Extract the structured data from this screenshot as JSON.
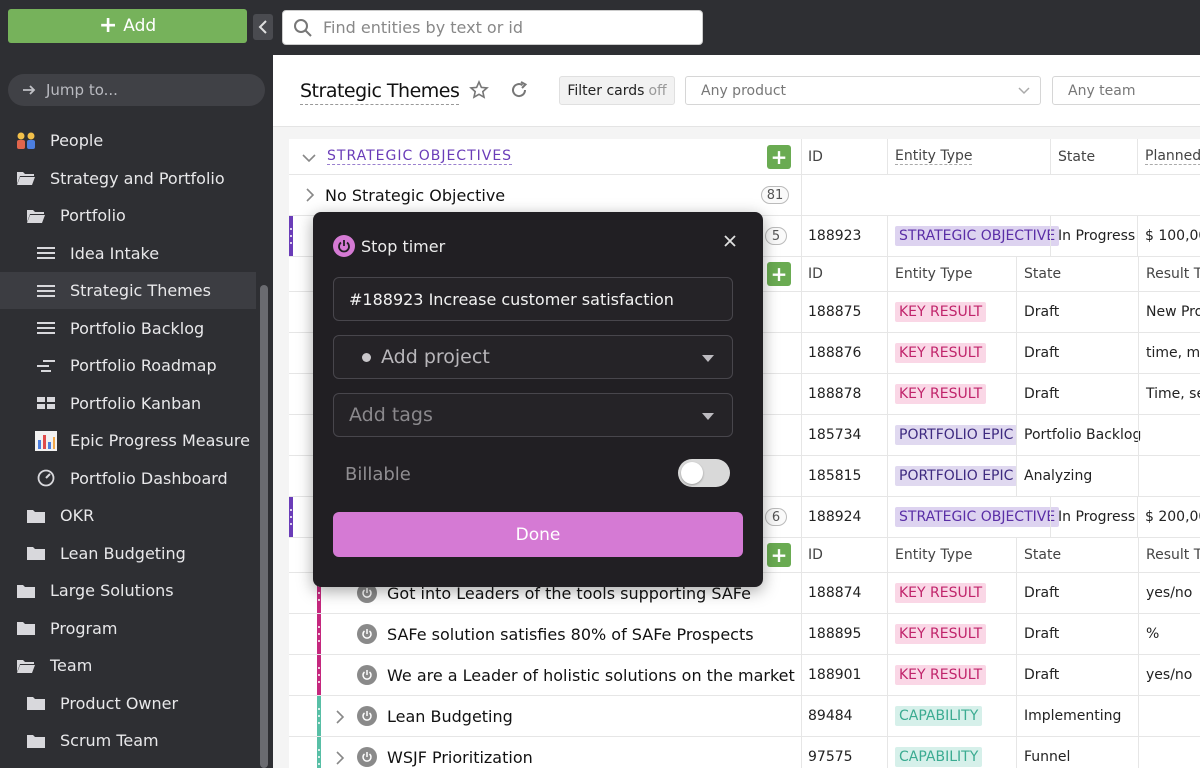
{
  "toolbar": {
    "add_label": "Add"
  },
  "search": {
    "placeholder": "Find entities by text or id"
  },
  "sidebar": {
    "jump_placeholder": "Jump to...",
    "items": [
      {
        "label": "People",
        "icon": "people-icon",
        "level": 0
      },
      {
        "label": "Strategy and Portfolio",
        "icon": "folder-open-icon",
        "level": 0
      },
      {
        "label": "Portfolio",
        "icon": "folder-open-icon",
        "level": 1
      },
      {
        "label": "Idea Intake",
        "icon": "list-icon",
        "level": 2
      },
      {
        "label": "Strategic Themes",
        "icon": "list-icon",
        "level": 2,
        "active": true
      },
      {
        "label": "Portfolio Backlog",
        "icon": "list-icon",
        "level": 2
      },
      {
        "label": "Portfolio Roadmap",
        "icon": "roadmap-icon",
        "level": 2
      },
      {
        "label": "Portfolio Kanban",
        "icon": "kanban-icon",
        "level": 2
      },
      {
        "label": "Epic Progress Measure",
        "icon": "bar-chart-icon",
        "level": 2
      },
      {
        "label": "Portfolio Dashboard",
        "icon": "dashboard-icon",
        "level": 2
      },
      {
        "label": "OKR",
        "icon": "folder-icon",
        "level": 1
      },
      {
        "label": "Lean Budgeting",
        "icon": "folder-icon",
        "level": 1
      },
      {
        "label": "Large Solutions",
        "icon": "folder-icon",
        "level": 0
      },
      {
        "label": "Program",
        "icon": "folder-icon",
        "level": 0
      },
      {
        "label": "Team",
        "icon": "folder-open-icon",
        "level": 0
      },
      {
        "label": "Product Owner",
        "icon": "folder-icon",
        "level": 1
      },
      {
        "label": "Scrum Team",
        "icon": "folder-icon",
        "level": 1
      }
    ]
  },
  "header": {
    "title": "Strategic Themes",
    "filter_label": "Filter cards",
    "filter_state": "off",
    "product_select": "Any product",
    "team_select": "Any team"
  },
  "table": {
    "group_label": "STRATEGIC OBJECTIVES",
    "columns": {
      "id": "ID",
      "entity_type": "Entity Type",
      "state": "State",
      "planned": "Planned",
      "result": "Result Ty"
    },
    "no_objective": {
      "label": "No Strategic Objective",
      "count": "81"
    },
    "objectives": [
      {
        "count": "5",
        "id": "188923",
        "type": "STRATEGIC OBJECTIVE",
        "state": "In Progress",
        "value": "$ 100,00"
      },
      {
        "count": "6",
        "id": "188924",
        "type": "STRATEGIC OBJECTIVE",
        "state": "In Progress",
        "value": "$ 200,00"
      }
    ],
    "children_a": [
      {
        "id": "188875",
        "type": "KEY RESULT",
        "state": "Draft",
        "result": "New Pro"
      },
      {
        "id": "188876",
        "type": "KEY RESULT",
        "state": "Draft",
        "result": "time, mi"
      },
      {
        "id": "188878",
        "type": "KEY RESULT",
        "state": "Draft",
        "result": "Time, se"
      },
      {
        "id": "185734",
        "type": "PORTFOLIO EPIC",
        "state": "Portfolio Backlog",
        "result": ""
      },
      {
        "id": "185815",
        "type": "PORTFOLIO EPIC",
        "state": "Analyzing",
        "result": ""
      }
    ],
    "children_b": [
      {
        "title": "Got into Leaders of the tools supporting SAFe",
        "id": "188874",
        "type": "KEY RESULT",
        "state": "Draft",
        "result": "yes/no"
      },
      {
        "title": "SAFe solution satisfies 80% of SAFe Prospects",
        "id": "188895",
        "type": "KEY RESULT",
        "state": "Draft",
        "result": "%"
      },
      {
        "title": "We are a Leader of holistic solutions on the market",
        "id": "188901",
        "type": "KEY RESULT",
        "state": "Draft",
        "result": "yes/no"
      },
      {
        "title": "Lean Budgeting",
        "id": "89484",
        "type": "CAPABILITY",
        "state": "Implementing",
        "result": ""
      },
      {
        "title": "WSJF Prioritization",
        "id": "97575",
        "type": "CAPABILITY",
        "state": "Funnel",
        "result": ""
      }
    ]
  },
  "modal": {
    "title": "Stop timer",
    "description": "#188923 Increase customer satisfaction",
    "project_placeholder": "Add project",
    "tags_placeholder": "Add tags",
    "billable_label": "Billable",
    "billable": false,
    "done_label": "Done"
  },
  "colors": {
    "sidebar_bg": "#2e2f33",
    "add_green": "#76b25b",
    "strategic_purple": "#5a2ea6",
    "key_result_pink": "#c0246b",
    "capability_teal": "#3bab91",
    "timer_accent": "#d57ad4",
    "modal_bg": "#211f23"
  }
}
